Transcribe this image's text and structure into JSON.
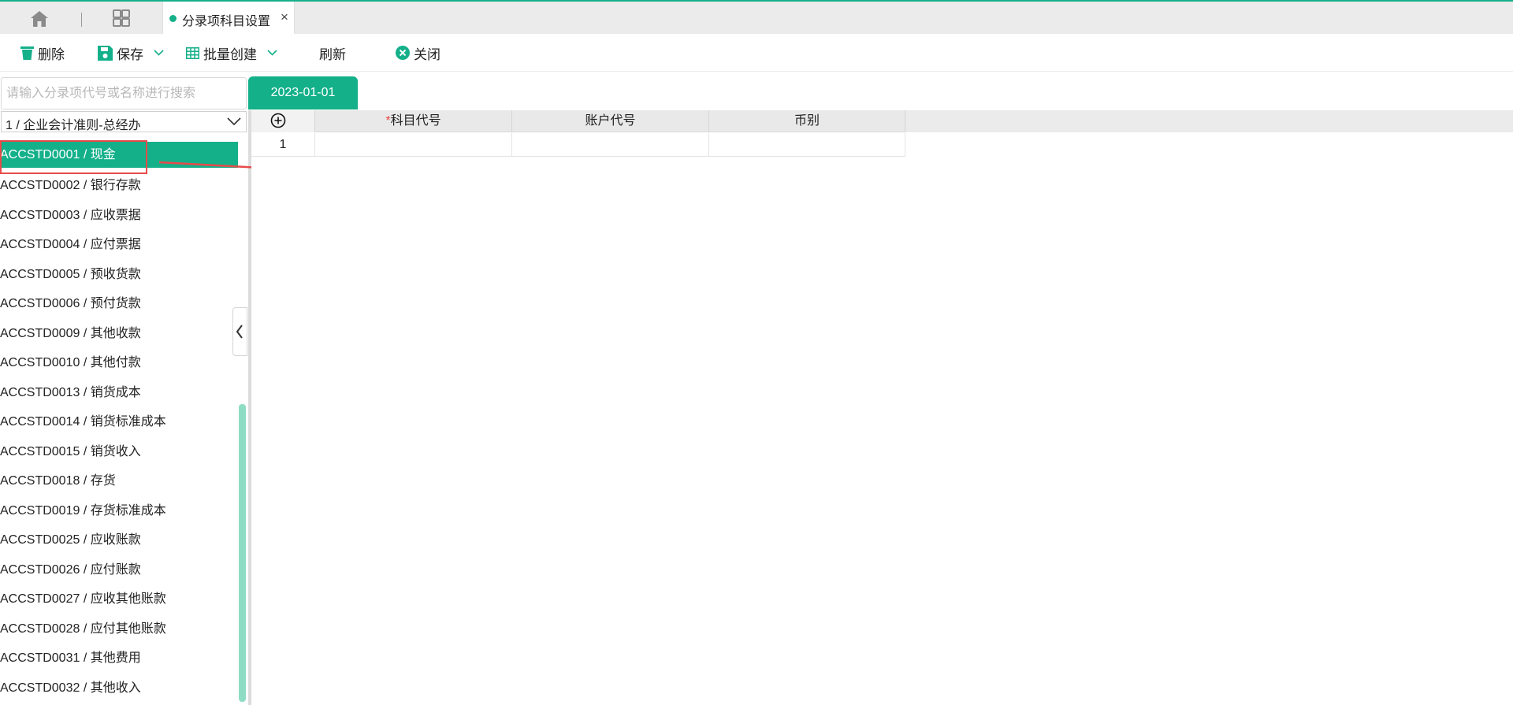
{
  "tabbar": {
    "active_tab_title": "分录项科目设置",
    "close_glyph": "×",
    "icons": [
      "home-icon",
      "grid-apps-icon",
      "close-icon"
    ]
  },
  "toolbar": {
    "delete_label": "删除",
    "save_label": "保存",
    "batch_create_label": "批量创建",
    "refresh_label": "刷新",
    "close_label": "关闭"
  },
  "left_panel": {
    "search_placeholder": "请输入分录项代号或名称进行搜索",
    "search_value": "",
    "selected_option": "1 / 企业会计准则-总经办",
    "items": [
      {
        "label": "ACCSTD0001 / 现金",
        "selected": true
      },
      {
        "label": "ACCSTD0002 / 银行存款",
        "selected": false
      },
      {
        "label": "ACCSTD0003 / 应收票据",
        "selected": false
      },
      {
        "label": "ACCSTD0004 / 应付票据",
        "selected": false
      },
      {
        "label": "ACCSTD0005 / 预收货款",
        "selected": false
      },
      {
        "label": "ACCSTD0006 / 预付货款",
        "selected": false
      },
      {
        "label": "ACCSTD0009 / 其他收款",
        "selected": false
      },
      {
        "label": "ACCSTD0010 / 其他付款",
        "selected": false
      },
      {
        "label": "ACCSTD0013 / 销货成本",
        "selected": false
      },
      {
        "label": "ACCSTD0014 / 销货标准成本",
        "selected": false
      },
      {
        "label": "ACCSTD0015 / 销货收入",
        "selected": false
      },
      {
        "label": "ACCSTD0018 / 存货",
        "selected": false
      },
      {
        "label": "ACCSTD0019 / 存货标准成本",
        "selected": false
      },
      {
        "label": "ACCSTD0025 / 应收账款",
        "selected": false
      },
      {
        "label": "ACCSTD0026 / 应付账款",
        "selected": false
      },
      {
        "label": "ACCSTD0027 / 应收其他账款",
        "selected": false
      },
      {
        "label": "ACCSTD0028 / 应付其他账款",
        "selected": false
      },
      {
        "label": "ACCSTD0031 / 其他费用",
        "selected": false
      },
      {
        "label": "ACCSTD0032 / 其他收入",
        "selected": false
      }
    ]
  },
  "main": {
    "date_tab": "2023-01-01",
    "grid": {
      "required_mark": "*",
      "columns": [
        "科目代号",
        "账户代号",
        "币别"
      ],
      "rows": [
        {
          "num": "1",
          "subject_code": "",
          "account_code": "",
          "currency": ""
        }
      ]
    }
  },
  "colors": {
    "accent": "#14b08a",
    "annotation": "#e84a4a",
    "scroll_thumb": "#8fdcc4"
  }
}
